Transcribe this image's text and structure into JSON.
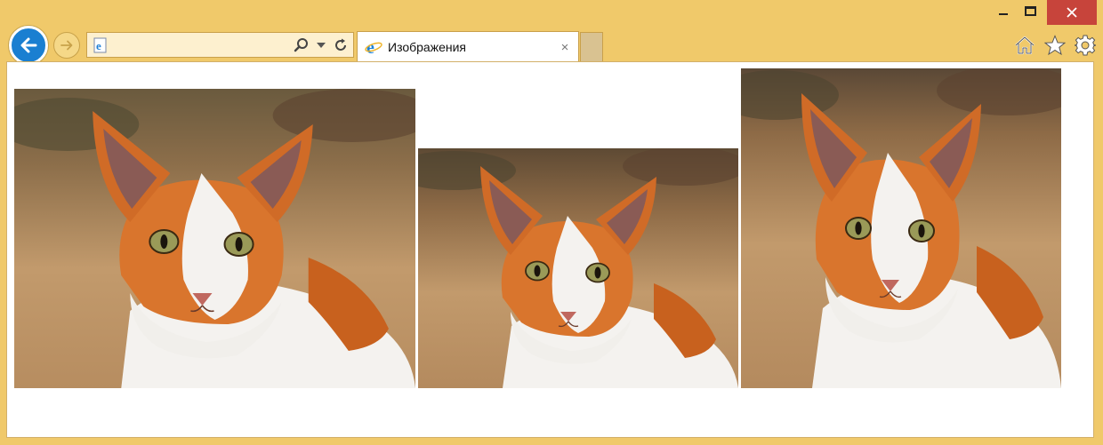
{
  "window": {
    "controls": [
      "minimize",
      "maximize",
      "close"
    ],
    "frame_color": "#f0c96a",
    "close_color": "#c7443b"
  },
  "address_bar": {
    "value": "",
    "icon": "ie-page-icon",
    "tools": [
      "search-icon",
      "dropdown-icon",
      "refresh-icon"
    ]
  },
  "tab": {
    "title": "Изображения",
    "icon": "ie-logo-icon",
    "close": "×"
  },
  "toolbar": {
    "icons": [
      "home-icon",
      "favorites-star-icon",
      "settings-gear-icon"
    ]
  },
  "content": {
    "images": [
      {
        "subject": "orange-and-white cat"
      },
      {
        "subject": "orange-and-white cat"
      },
      {
        "subject": "orange-and-white cat"
      }
    ]
  }
}
